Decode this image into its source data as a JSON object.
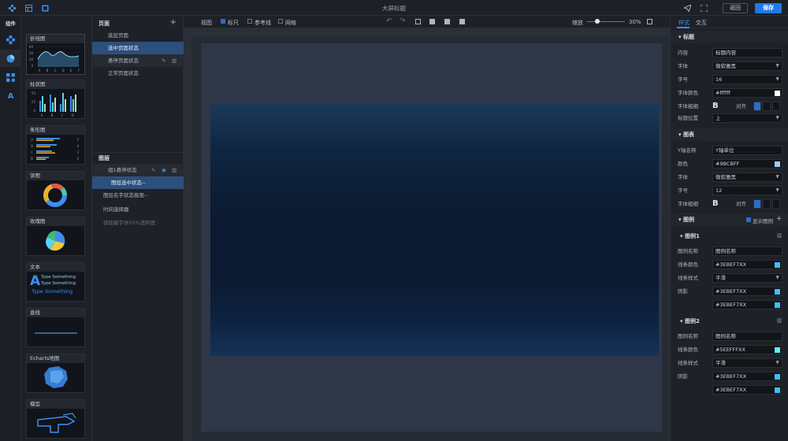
{
  "header": {
    "title": "大屏标题",
    "back_label": "返回",
    "save_label": "保存"
  },
  "rail": {
    "label": "组件"
  },
  "components": [
    {
      "label": "折线图",
      "icon": "line-chart-icon"
    },
    {
      "label": "柱状图",
      "icon": "bar-chart-icon"
    },
    {
      "label": "条形图",
      "icon": "hbar-chart-icon"
    },
    {
      "label": "饼图",
      "icon": "pie-chart-icon"
    },
    {
      "label": "玫瑰图",
      "icon": "rose-chart-icon"
    },
    {
      "label": "文本",
      "icon": "text-icon",
      "sample": "Type Something"
    },
    {
      "label": "直线",
      "icon": "line-icon"
    },
    {
      "label": "Echarts地图",
      "icon": "map-icon"
    },
    {
      "label": "模型",
      "icon": "model-icon"
    }
  ],
  "line_preview": {
    "y_ticks": [
      "60",
      "40",
      "20",
      "0"
    ],
    "x_ticks": [
      "A",
      "B",
      "C",
      "D",
      "E",
      "F"
    ]
  },
  "bar_preview": {
    "y_ticks": [
      "50",
      "25",
      "0"
    ],
    "x_ticks": [
      "A",
      "B",
      "C",
      "D"
    ]
  },
  "hbar_preview": {
    "y_ticks": [
      "A",
      "B",
      "C",
      "D"
    ],
    "values_right": [
      "5",
      "4",
      "3",
      "2"
    ]
  },
  "pages": {
    "title": "页面",
    "add": "+",
    "items": [
      "底层页面",
      "选中页面状态",
      "悬停页面状态",
      "正常页面状态"
    ]
  },
  "layers": {
    "title": "图层",
    "items": [
      "组1悬停状态",
      "图层选中状态--",
      "图层名字状态极限--",
      "时间选择器",
      "锁隐藏字体50%透明度"
    ]
  },
  "toolbar": {
    "view": "视图",
    "ruler": "标尺",
    "guides": "参考线",
    "grid": "网格",
    "zoom_label": "缩放",
    "zoom_value": "30%"
  },
  "panel": {
    "tabs": [
      "样式",
      "交互"
    ],
    "title_section": "标题",
    "title_rows": [
      {
        "label": "内容",
        "value": "标题内容"
      },
      {
        "label": "字体",
        "value": "微软雅黑"
      },
      {
        "label": "字号",
        "value": "16"
      },
      {
        "label": "字体颜色",
        "value": "#ffffff"
      },
      {
        "label": "字体粗细",
        "value": "B"
      },
      {
        "label": "标题位置",
        "value": "上"
      }
    ],
    "align_label": "对齐",
    "chart_section": "图表",
    "chart_rows": [
      {
        "label": "Y轴名称",
        "value": "Y轴单位"
      },
      {
        "label": "颜色",
        "value": "#9BCBFF"
      },
      {
        "label": "字体",
        "value": "微软雅黑"
      },
      {
        "label": "字号",
        "value": "12"
      },
      {
        "label": "字体粗细",
        "value": "B"
      }
    ],
    "legend_section": "图例",
    "legend_toggle": "显示图例",
    "legend1": {
      "title": "图例1",
      "name_label": "图例名称",
      "name": "图例名称",
      "color_label": "线条颜色",
      "color": "#3EBEF7XX",
      "style_label": "线条样式",
      "style": "平滑",
      "shadow_label": "阴影",
      "shadow1": "#3EBEF7XX",
      "shadow2": "#3EBEF7XX"
    },
    "legend2": {
      "title": "图例2",
      "name_label": "图例名称",
      "name": "图例名称",
      "color_label": "线条颜色",
      "color": "#5EEFFFXX",
      "style_label": "线条样式",
      "style": "平滑",
      "shadow_label": "阴影",
      "shadow1": "#3EBEF7XX",
      "shadow2": "#3EBEF7XX"
    }
  },
  "colors": {
    "accent": "#1f7ae6",
    "selected_row": "#2d4f7c",
    "legend1": "#3EBEF7",
    "legend2": "#5EEFFF"
  }
}
